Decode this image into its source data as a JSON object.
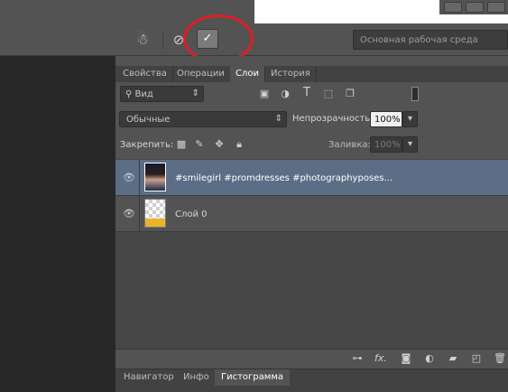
{
  "options_bar": {
    "workspace_label": "Основная рабочая среда",
    "icons": [
      "puppet-warp-icon",
      "cancel-icon",
      "commit-checkmark-icon"
    ]
  },
  "panel_tabs": [
    {
      "label": "Свойства",
      "active": false
    },
    {
      "label": "Операции",
      "active": false
    },
    {
      "label": "Слои",
      "active": true
    },
    {
      "label": "История",
      "active": false
    }
  ],
  "layers": {
    "filter_kind": "Вид",
    "blend_mode": "Обычные",
    "opacity_label": "Непрозрачность:",
    "opacity_value": "100%",
    "lock_label": "Закрепить:",
    "fill_label": "Заливка:",
    "fill_value": "100%",
    "items": [
      {
        "name": "#smilegirl #promdresses #photographyposes...",
        "visible": true,
        "selected": true
      },
      {
        "name": "Слой 0",
        "visible": true,
        "selected": false
      }
    ]
  },
  "bottom_tabs": [
    {
      "label": "Навигатор",
      "active": false
    },
    {
      "label": "Инфо",
      "active": false
    },
    {
      "label": "Гистограмма",
      "active": true
    }
  ],
  "colors": {
    "highlight_circle": "#e01d24",
    "selected_row": "#5b6e85"
  }
}
